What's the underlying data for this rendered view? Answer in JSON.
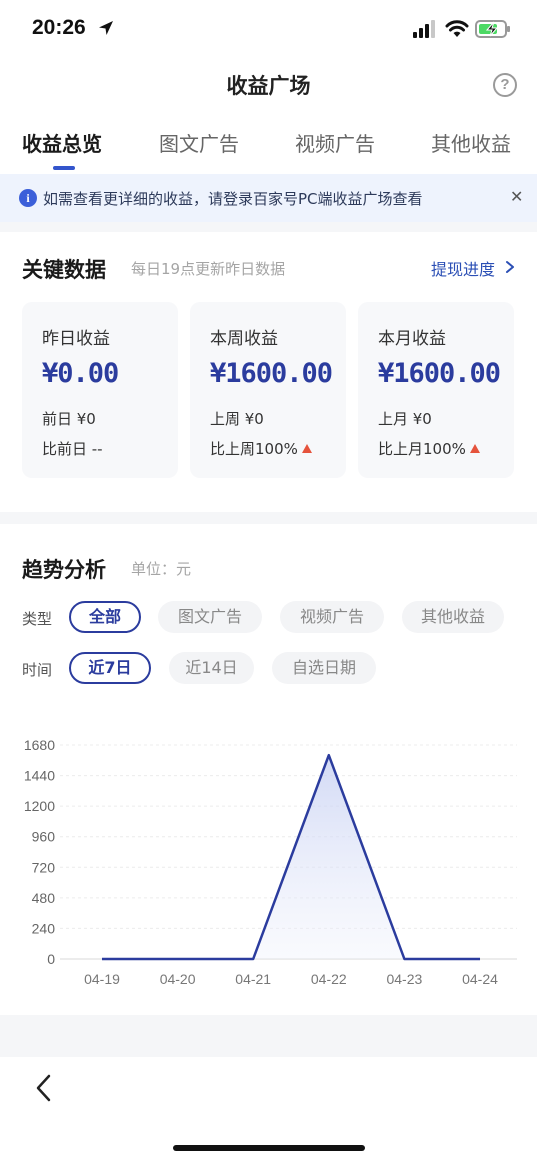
{
  "status_bar": {
    "time": "20:26"
  },
  "header": {
    "title": "收益广场",
    "help_icon": "question-circle-icon"
  },
  "tabs": [
    {
      "label": "收益总览",
      "active": true
    },
    {
      "label": "图文广告",
      "active": false
    },
    {
      "label": "视频广告",
      "active": false
    },
    {
      "label": "其他收益",
      "active": false
    }
  ],
  "notice": {
    "text": "如需查看更详细的收益，请登录百家号PC端收益广场查看"
  },
  "key_data": {
    "title": "关键数据",
    "subtitle": "每日19点更新昨日数据",
    "withdraw_link": "提现进度",
    "cards": [
      {
        "label": "昨日收益",
        "value": "¥0.00",
        "prev": "前日 ¥0",
        "compare": "比前日 --",
        "trend_up": false
      },
      {
        "label": "本周收益",
        "value": "¥1600.00",
        "prev": "上周 ¥0",
        "compare": "比上周100%",
        "trend_up": true
      },
      {
        "label": "本月收益",
        "value": "¥1600.00",
        "prev": "上月 ¥0",
        "compare": "比上月100%",
        "trend_up": true
      }
    ]
  },
  "trend": {
    "title": "趋势分析",
    "unit": "单位：元",
    "type_label": "类型",
    "type_options": [
      {
        "label": "全部",
        "active": true
      },
      {
        "label": "图文广告",
        "active": false
      },
      {
        "label": "视频广告",
        "active": false
      },
      {
        "label": "其他收益",
        "active": false
      }
    ],
    "time_label": "时间",
    "time_options": [
      {
        "label": "近7日",
        "active": true
      },
      {
        "label": "近14日",
        "active": false
      },
      {
        "label": "自选日期",
        "active": false
      }
    ]
  },
  "colors": {
    "accent": "#2b3c9e",
    "link": "#2b4fb5",
    "up": "#e5533c",
    "notice_bg": "#eef3fd"
  },
  "chart_data": {
    "type": "area",
    "categories": [
      "04-19",
      "04-20",
      "04-21",
      "04-22",
      "04-23",
      "04-24"
    ],
    "values": [
      0,
      0,
      0,
      1600,
      0,
      0
    ],
    "yticks": [
      0,
      240,
      480,
      720,
      960,
      1200,
      1440,
      1680
    ],
    "ylim": [
      0,
      1680
    ],
    "grid": true
  }
}
